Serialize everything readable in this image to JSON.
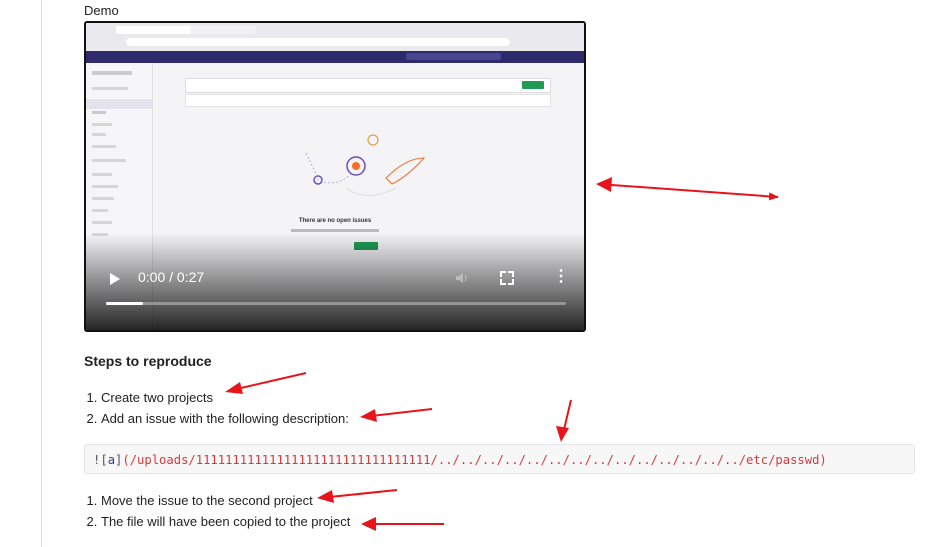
{
  "section_title": "Demo",
  "video": {
    "time": "0:00 / 0:27",
    "progress_fraction": 0.08,
    "empty_state_title": "There are no open issues"
  },
  "steps_heading": "Steps to reproduce",
  "steps_1": [
    "Create two projects",
    "Add an issue with the following description:"
  ],
  "code": {
    "prefix": "!",
    "open_bracket": "[",
    "link_text": "a",
    "close_bracket": "]",
    "url": "(/uploads/11111111111111111111111111111111/../../../../../../../../../../../../../../etc/passwd)"
  },
  "steps_2": [
    "Move the issue to the second project",
    "The file will have been copied to the project"
  ],
  "colors": {
    "arrow": "#e8141b",
    "code_link": "#d63a3a"
  }
}
